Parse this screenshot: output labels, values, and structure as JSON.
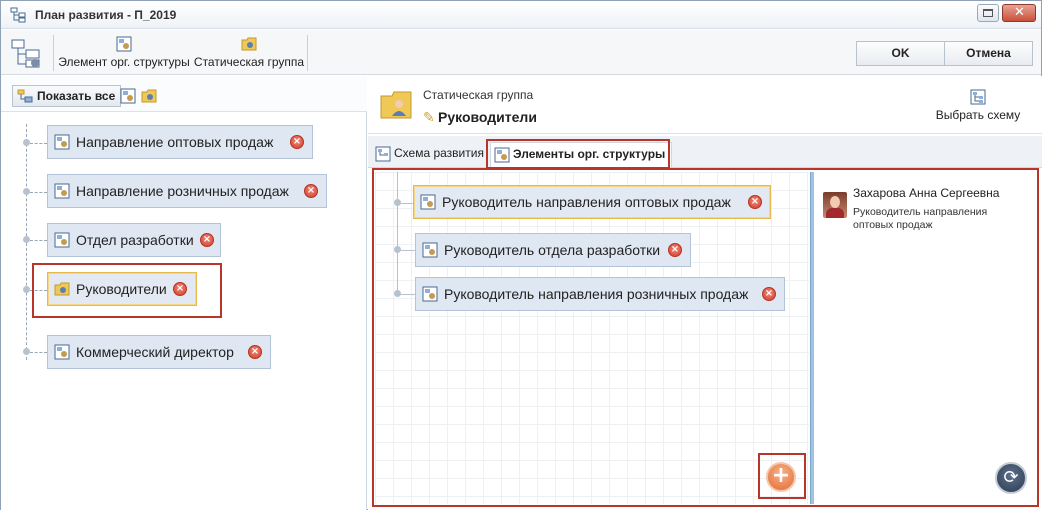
{
  "window": {
    "title": "План развития - П_2019",
    "icon": "org-chart-icon"
  },
  "toolbar": {
    "org_element_label": "Элемент орг. структуры",
    "static_group_label": "Статическая группа",
    "ok_label": "OK",
    "cancel_label": "Отмена"
  },
  "left": {
    "show_all_label": "Показать все",
    "nodes": [
      {
        "label": "Направление оптовых продаж",
        "icon": "org-unit-icon"
      },
      {
        "label": "Направление розничных продаж",
        "icon": "org-unit-icon"
      },
      {
        "label": "Отдел разработки",
        "icon": "org-unit-icon"
      },
      {
        "label": "Руководители",
        "icon": "static-group-folder-icon"
      },
      {
        "label": "Коммерческий директор",
        "icon": "org-unit-icon"
      }
    ]
  },
  "right": {
    "kind": "Статическая группа",
    "name": "Руководители",
    "choose_scheme_label": "Выбрать схему",
    "tabs": [
      {
        "label": "Схема развития",
        "active": false
      },
      {
        "label": "Элементы орг. структуры",
        "active": true
      }
    ],
    "canvas_nodes": [
      {
        "label": "Руководитель направления оптовых продаж",
        "selected": true
      },
      {
        "label": "Руководитель отдела разработки",
        "selected": false
      },
      {
        "label": "Руководитель направления розничных продаж",
        "selected": false
      }
    ],
    "details": {
      "person_name": "Захарова Анна Сергеевна",
      "person_role": "Руководитель направления оптовых продаж"
    }
  },
  "colors": {
    "highlight_frame": "#b8352a",
    "node_fill": "#dfe7f2",
    "selected_border": "#e8b84a",
    "add_button": "#e26b33"
  }
}
